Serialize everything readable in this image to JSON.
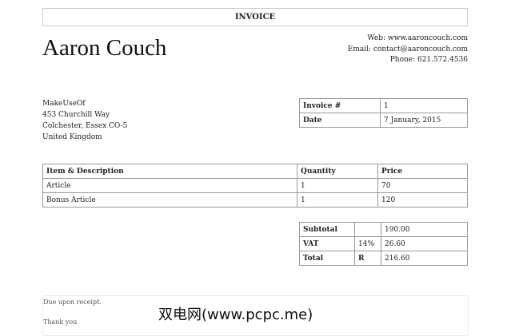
{
  "header": {
    "title": "INVOICE"
  },
  "company": {
    "name": "Aaron Couch",
    "web": "Web: www.aaroncouch.com",
    "email": "Email: contact@aaroncouch.com",
    "phone": "Phone: 621.572.4536"
  },
  "client": {
    "lines": [
      "MakeUseOf",
      "453 Churchill Way",
      "Colchester, Essex CO-5",
      "United Kingdom"
    ]
  },
  "meta": {
    "invoice_label": "Invoice #",
    "invoice_value": "1",
    "date_label": "Date",
    "date_value": "7 January, 2015"
  },
  "items": {
    "headers": [
      "Item & Description",
      "Quantity",
      "Price"
    ],
    "rows": [
      [
        "Article",
        "1",
        "70"
      ],
      [
        "Bonus Article",
        "1",
        "120"
      ]
    ]
  },
  "totals": {
    "subtotal_label": "Subtotal",
    "subtotal": "190.00",
    "vat_label": "VAT",
    "vat_rate": "14%",
    "vat": "26.60",
    "total_label": "Total",
    "currency": "R",
    "total": "216.60"
  },
  "footer": {
    "terms": "Due upon receipt.",
    "thanks": "Thank you"
  },
  "watermark": "双电网(www.pcpc.me)"
}
